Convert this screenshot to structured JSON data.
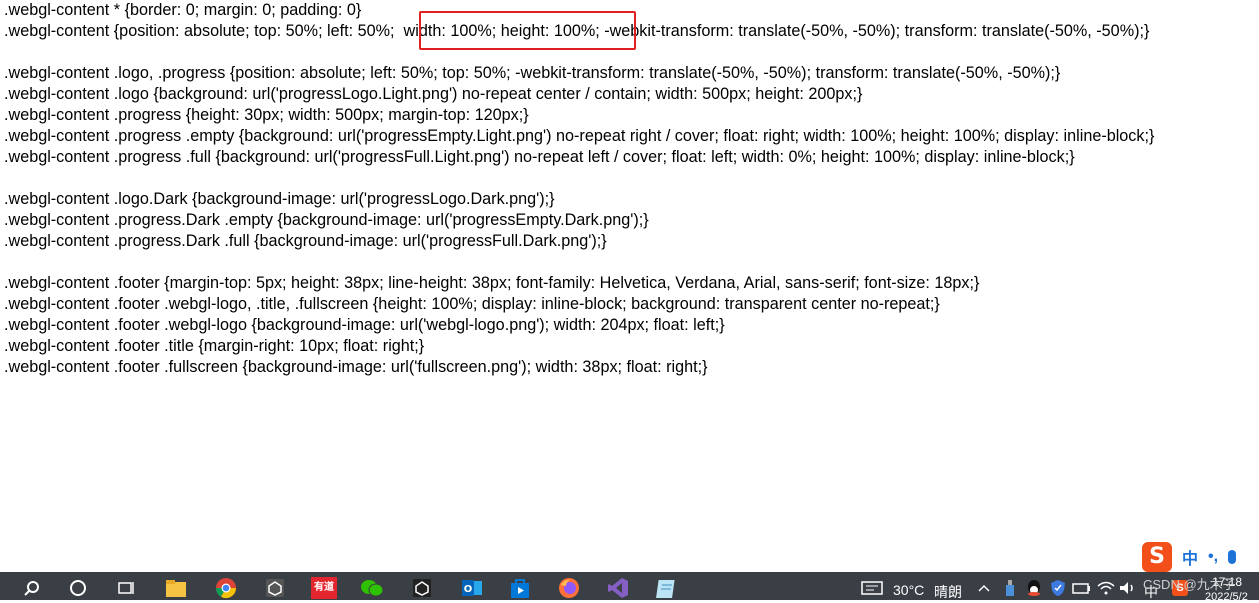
{
  "code_lines": [
    ".webgl-content * {border: 0; margin: 0; padding: 0}",
    ".webgl-content {position: absolute; top: 50%; left: 50%;  width: 100%; height: 100%; -webkit-transform: translate(-50%, -50%); transform: translate(-50%, -50%);}",
    "",
    ".webgl-content .logo, .progress {position: absolute; left: 50%; top: 50%; -webkit-transform: translate(-50%, -50%); transform: translate(-50%, -50%);}",
    ".webgl-content .logo {background: url('progressLogo.Light.png') no-repeat center / contain; width: 500px; height: 200px;}",
    ".webgl-content .progress {height: 30px; width: 500px; margin-top: 120px;}",
    ".webgl-content .progress .empty {background: url('progressEmpty.Light.png') no-repeat right / cover; float: right; width: 100%; height: 100%; display: inline-block;}",
    ".webgl-content .progress .full {background: url('progressFull.Light.png') no-repeat left / cover; float: left; width: 0%; height: 100%; display: inline-block;}",
    "",
    ".webgl-content .logo.Dark {background-image: url('progressLogo.Dark.png');}",
    ".webgl-content .progress.Dark .empty {background-image: url('progressEmpty.Dark.png');}",
    ".webgl-content .progress.Dark .full {background-image: url('progressFull.Dark.png');}",
    "",
    ".webgl-content .footer {margin-top: 5px; height: 38px; line-height: 38px; font-family: Helvetica, Verdana, Arial, sans-serif; font-size: 18px;}",
    ".webgl-content .footer .webgl-logo, .title, .fullscreen {height: 100%; display: inline-block; background: transparent center no-repeat;}",
    ".webgl-content .footer .webgl-logo {background-image: url('webgl-logo.png'); width: 204px; float: left;}",
    ".webgl-content .footer .title {margin-right: 10px; float: right;}",
    ".webgl-content .footer .fullscreen {background-image: url('fullscreen.png'); width: 38px; float: right;}"
  ],
  "ime": {
    "logo_char": "S",
    "mode_label": "中",
    "punct_label": "•,"
  },
  "taskbar": {
    "icons": [
      "search-icon",
      "cortana-circle-icon",
      "task-view-icon",
      "file-explorer-icon",
      "chrome-icon",
      "unity-icon",
      "youdao-icon",
      "wechat-icon",
      "unity-hub-icon",
      "outlook-icon",
      "windows-store-icon",
      "firefox-icon",
      "visual-studio-icon",
      "notepad-icon"
    ],
    "youdao_label": "有道",
    "weather_temp": "30°C",
    "weather_desc": "晴朗",
    "input_lang": "中",
    "time": "17:18",
    "date": "2022/5/2"
  },
  "watermark": "CSDN @九木子",
  "colors": {
    "highlight_border": "#e02020",
    "taskbar_bg": "#3a3f45",
    "ime_accent": "#f24f1a"
  }
}
